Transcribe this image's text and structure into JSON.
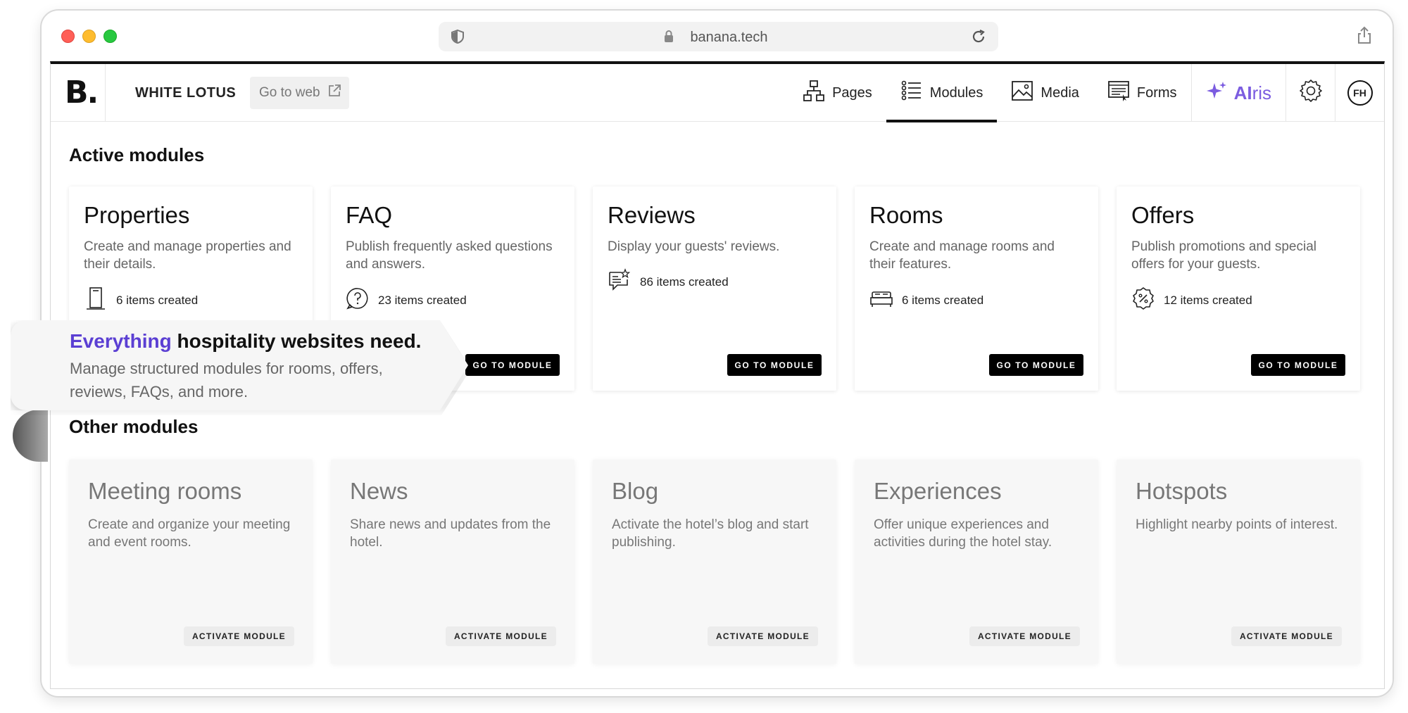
{
  "browser": {
    "url": "banana.tech"
  },
  "app": {
    "logo": "B.",
    "site_name": "WHITE LOTUS",
    "goto_web": "Go to web",
    "nav": {
      "pages": "Pages",
      "modules": "Modules",
      "media": "Media",
      "forms": "Forms",
      "airis_ai": "AI",
      "airis_ris": "ris",
      "avatar": "FH"
    }
  },
  "active_section": {
    "title": "Active modules",
    "button_label": "GO TO MODULE",
    "cards": [
      {
        "title": "Properties",
        "desc": "Create and manage properties and their details.",
        "count": "6 items created",
        "icon": "building-icon"
      },
      {
        "title": "FAQ",
        "desc": "Publish frequently asked questions and answers.",
        "count": "23 items created",
        "icon": "question-bubble-icon"
      },
      {
        "title": "Reviews",
        "desc": "Display your guests' reviews.",
        "count": "86 items created",
        "icon": "review-icon"
      },
      {
        "title": "Rooms",
        "desc": "Create and manage rooms and their features.",
        "count": "6 items created",
        "icon": "bed-icon"
      },
      {
        "title": "Offers",
        "desc": "Publish promotions and special offers for your guests.",
        "count": "12 items created",
        "icon": "discount-badge-icon"
      }
    ]
  },
  "other_section": {
    "title": "Other modules",
    "button_label": "ACTIVATE MODULE",
    "cards": [
      {
        "title": "Meeting rooms",
        "desc": "Create and organize your meeting and event rooms."
      },
      {
        "title": "News",
        "desc": "Share news and updates from the hotel."
      },
      {
        "title": "Blog",
        "desc": "Activate the hotel’s blog and start publishing."
      },
      {
        "title": "Experiences",
        "desc": "Offer unique experiences and activities during the hotel stay."
      },
      {
        "title": "Hotspots",
        "desc": "Highlight nearby points of interest."
      }
    ]
  },
  "callout": {
    "accent": "Everything",
    "headline": " hospitality websites need.",
    "sub": "Manage structured modules for rooms, offers, reviews, FAQs, and more."
  },
  "colors": {
    "accent_purple": "#5b3fd3",
    "airis_purple": "#7b5ce0",
    "button_black": "#000000"
  }
}
